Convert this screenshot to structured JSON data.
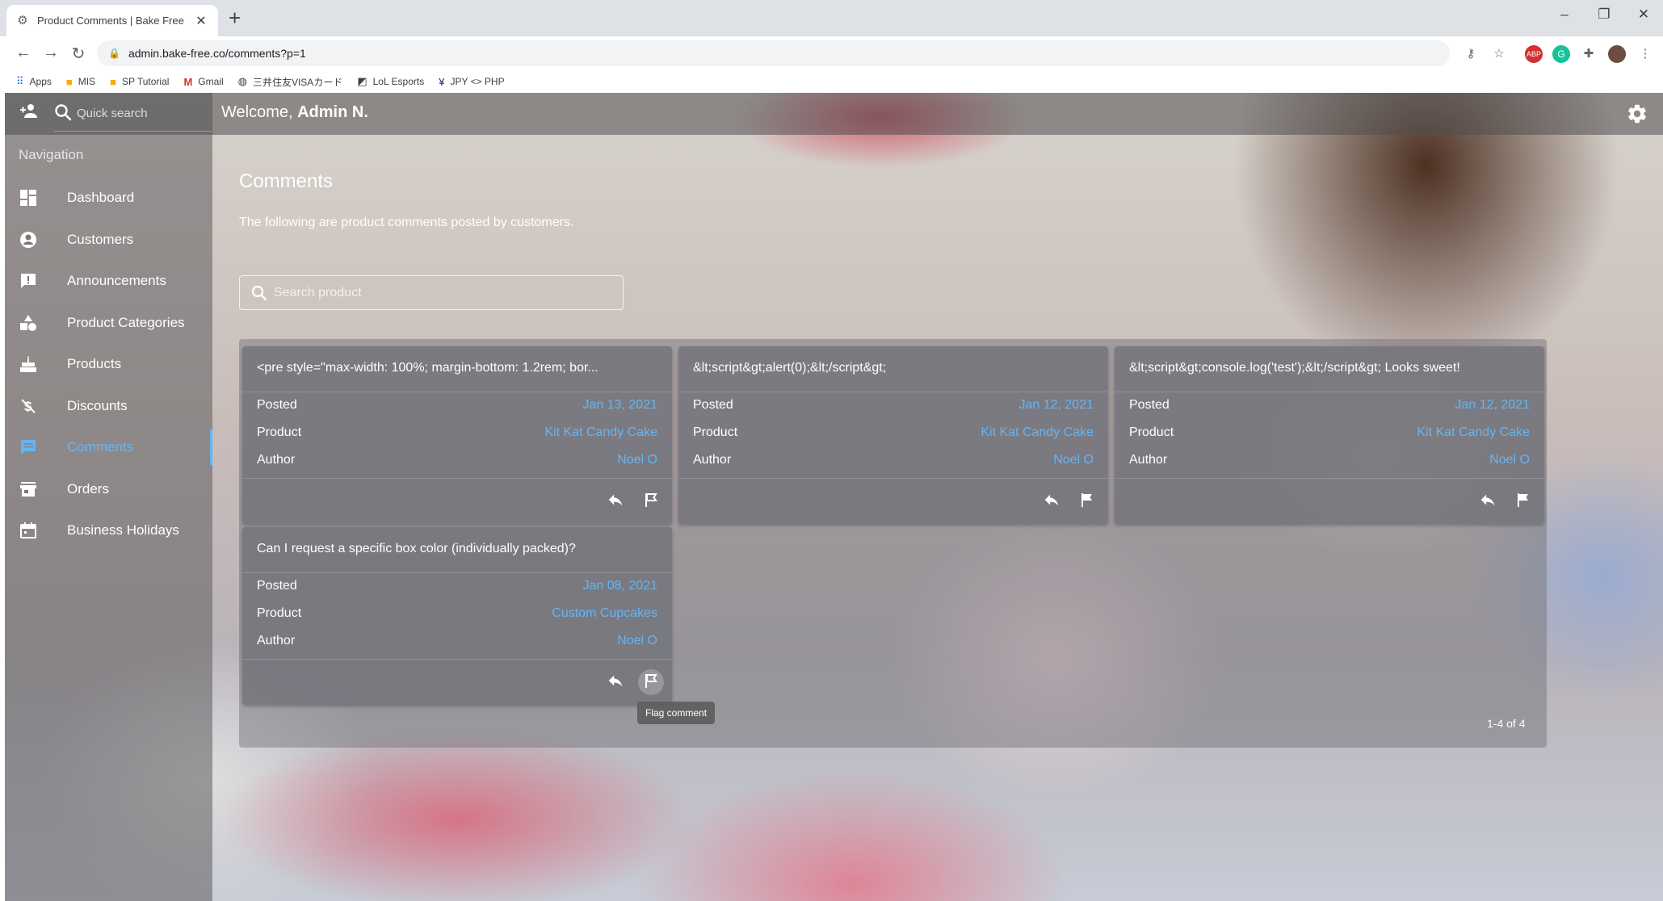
{
  "browser": {
    "tab_title": "Product Comments | Bake Free A",
    "url": "admin.bake-free.co/comments?p=1",
    "bookmarks": [
      {
        "label": "Apps",
        "icon": "apps-grid-icon"
      },
      {
        "label": "MIS",
        "icon": "folder-icon"
      },
      {
        "label": "SP Tutorial",
        "icon": "folder-icon"
      },
      {
        "label": "Gmail",
        "icon": "gmail-icon"
      },
      {
        "label": "三井住友VISAカード",
        "icon": "globe-icon"
      },
      {
        "label": "LoL Esports",
        "icon": "lol-icon"
      },
      {
        "label": "JPY <> PHP",
        "icon": "currency-icon"
      }
    ]
  },
  "topbar": {
    "quick_search": "Quick search",
    "welcome_prefix": "Welcome, ",
    "welcome_name": "Admin N."
  },
  "sidebar": {
    "header": "Navigation",
    "items": [
      {
        "label": "Dashboard",
        "icon": "dashboard-icon"
      },
      {
        "label": "Customers",
        "icon": "account-circle-icon"
      },
      {
        "label": "Announcements",
        "icon": "announcement-icon"
      },
      {
        "label": "Product Categories",
        "icon": "shapes-icon"
      },
      {
        "label": "Products",
        "icon": "cake-icon"
      },
      {
        "label": "Discounts",
        "icon": "money-off-icon"
      },
      {
        "label": "Comments",
        "icon": "comment-icon",
        "active": true
      },
      {
        "label": "Orders",
        "icon": "store-icon"
      },
      {
        "label": "Business Holidays",
        "icon": "calendar-icon"
      }
    ]
  },
  "main": {
    "title": "Comments",
    "subtitle": "The following are product comments posted by customers.",
    "search_placeholder": "Search product",
    "labels": {
      "posted": "Posted",
      "product": "Product",
      "author": "Author"
    },
    "comments": [
      {
        "text": "<pre style=\"max-width: 100%; margin-bottom: 1.2rem; bor...",
        "posted": "Jan 13, 2021",
        "product": "Kit Kat Candy Cake",
        "author": "Noel O",
        "flagged": false
      },
      {
        "text": "&lt;script&gt;alert(0);&lt;/script&gt;",
        "posted": "Jan 12, 2021",
        "product": "Kit Kat Candy Cake",
        "author": "Noel O",
        "flagged": true
      },
      {
        "text": "&lt;script&gt;console.log('test');&lt;/script&gt; Looks sweet!",
        "posted": "Jan 12, 2021",
        "product": "Kit Kat Candy Cake",
        "author": "Noel O",
        "flagged": true
      },
      {
        "text": "Can I request a specific box color (individually packed)?",
        "posted": "Jan 08, 2021",
        "product": "Custom Cupcakes",
        "author": "Noel O",
        "flagged": false
      }
    ],
    "tooltip": "Flag comment",
    "pagination": "1-4 of 4"
  },
  "colors": {
    "accent": "#64b5f6",
    "text": "#ffffff"
  }
}
